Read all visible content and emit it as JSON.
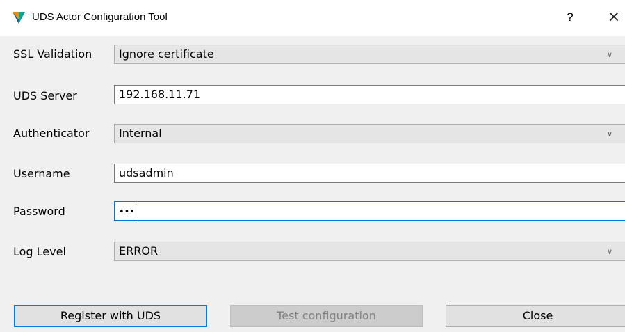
{
  "window": {
    "title": "UDS Actor Configuration Tool",
    "help_label": "?",
    "close_label": "×"
  },
  "form": {
    "ssl_validation": {
      "label": "SSL Validation",
      "value": "Ignore certificate"
    },
    "uds_server": {
      "label": "UDS Server",
      "value": "192.168.11.71"
    },
    "authenticator": {
      "label": "Authenticator",
      "value": "Internal"
    },
    "username": {
      "label": "Username",
      "value": "udsadmin"
    },
    "password": {
      "label": "Password",
      "value": "•••"
    },
    "log_level": {
      "label": "Log Level",
      "value": "ERROR"
    }
  },
  "buttons": {
    "register": "Register with UDS",
    "test": "Test configuration",
    "close": "Close"
  },
  "icons": {
    "app": "uds-logo-icon",
    "dropdown": "chevron-down-icon"
  },
  "colors": {
    "focus_border": "#0078d7",
    "logo_orange": "#f39200",
    "logo_teal": "#00a6a6"
  }
}
